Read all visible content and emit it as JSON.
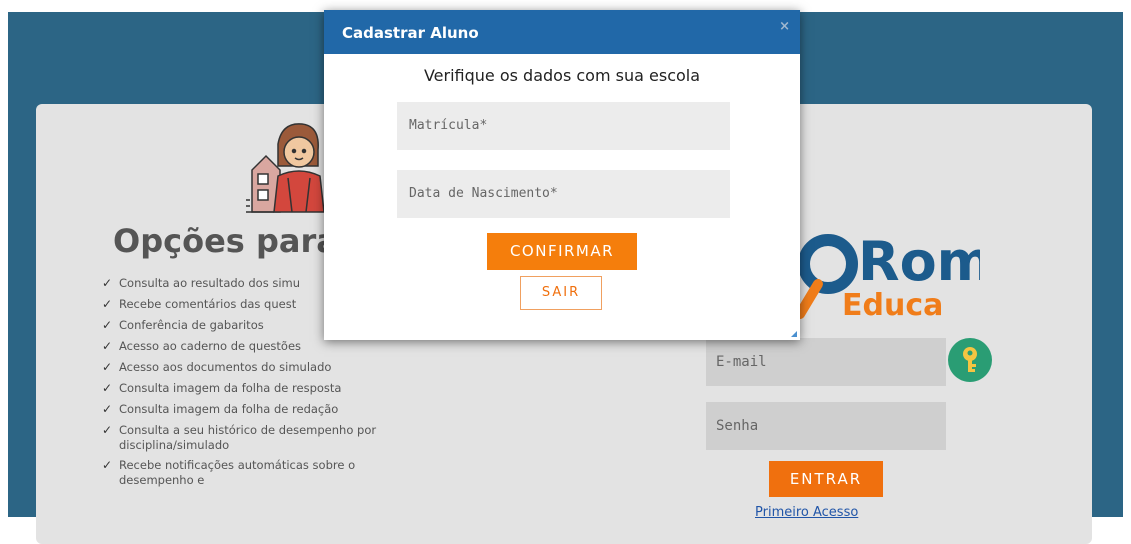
{
  "modal": {
    "title": "Cadastrar Aluno",
    "close_icon": "×",
    "subtitle": "Verifique os dados com sua escola",
    "matricula_placeholder": "Matrícula*",
    "nascimento_placeholder": "Data de Nascimento*",
    "confirm_label": "CONFIRMAR",
    "exit_label": "SAIR"
  },
  "background_page": {
    "options_title": "Opções para",
    "features": [
      "Consulta ao resultado dos simu",
      "Recebe comentários das quest",
      "Conferência de gabaritos",
      "Acesso ao caderno de questões",
      "Acesso aos documentos do simulado",
      "Consulta imagem da folha de resposta",
      "Consulta imagem da folha de redação",
      "Consulta a seu histórico de desempenho por disciplina/simulado",
      "Recebe notificações automáticas sobre o desempenho e"
    ],
    "logo": {
      "word_main": "Rom",
      "word_sub": "Educa"
    },
    "login": {
      "email_placeholder": "E-mail",
      "password_placeholder": "Senha",
      "submit_label": "ENTRAR",
      "first_access_link": "Primeiro Acesso",
      "key_icon": "key-icon"
    }
  },
  "colors": {
    "page_background": "#2c6585",
    "card": "#e3e3e3",
    "modal_header": "#2168a8",
    "accent_orange": "#f57e0c",
    "key_button": "#2a9d74",
    "logo_blue": "#1c5b8c",
    "logo_orange": "#f07d1a"
  }
}
